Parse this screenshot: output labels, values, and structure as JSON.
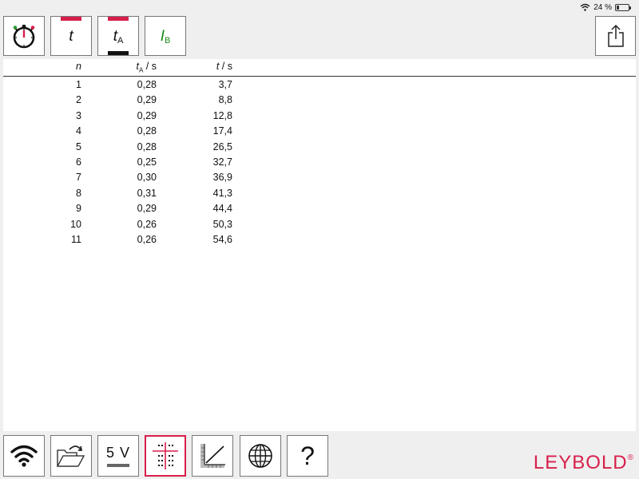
{
  "status": {
    "battery_text": "24 %",
    "battery_level": 0.24
  },
  "toolbar": {
    "quantity_t": {
      "symbol": "t"
    },
    "quantity_ta": {
      "symbol": "t",
      "subscript": "A"
    },
    "quantity_ib": {
      "symbol": "I",
      "subscript": "B",
      "color": "#1a8a1a"
    }
  },
  "table": {
    "headers": [
      {
        "symbol": "n",
        "subscript": "",
        "unit": ""
      },
      {
        "symbol": "t",
        "subscript": "A",
        "unit": " / s"
      },
      {
        "symbol": "t",
        "subscript": "",
        "unit": " / s"
      }
    ],
    "rows": [
      [
        "1",
        "0,28",
        "3,7"
      ],
      [
        "2",
        "0,29",
        "8,8"
      ],
      [
        "3",
        "0,29",
        "12,8"
      ],
      [
        "4",
        "0,28",
        "17,4"
      ],
      [
        "5",
        "0,28",
        "26,5"
      ],
      [
        "6",
        "0,25",
        "32,7"
      ],
      [
        "7",
        "0,30",
        "36,9"
      ],
      [
        "8",
        "0,31",
        "41,3"
      ],
      [
        "9",
        "0,29",
        "44,4"
      ],
      [
        "10",
        "0,26",
        "50,3"
      ],
      [
        "11",
        "0,26",
        "54,6"
      ]
    ]
  },
  "bottom": {
    "voltage_label": "5 V",
    "help_label": "?"
  },
  "brand": {
    "name": "LEYBOLD",
    "mark": "®",
    "color": "#d81e4b"
  },
  "colors": {
    "accent": "#d81e4b"
  }
}
